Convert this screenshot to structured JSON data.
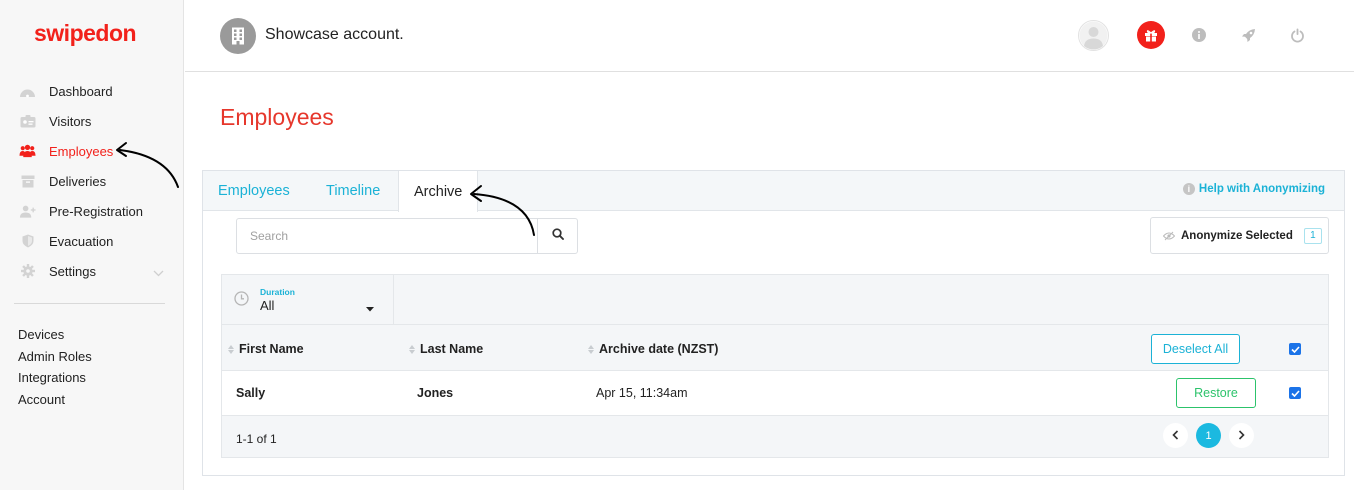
{
  "brand": {
    "logo": "swipedon",
    "accent": "#f2211b",
    "teal": "#1bb2d6",
    "green": "#2cc36b"
  },
  "sidebar": {
    "items": [
      {
        "label": "Dashboard",
        "icon": "dashboard-icon"
      },
      {
        "label": "Visitors",
        "icon": "visitors-icon"
      },
      {
        "label": "Employees",
        "icon": "employees-icon",
        "active": true
      },
      {
        "label": "Deliveries",
        "icon": "deliveries-icon"
      },
      {
        "label": "Pre-Registration",
        "icon": "pre-registration-icon"
      },
      {
        "label": "Evacuation",
        "icon": "evacuation-icon"
      },
      {
        "label": "Settings",
        "icon": "settings-icon",
        "expandable": true
      }
    ],
    "secondary": [
      "Devices",
      "Admin Roles",
      "Integrations",
      "Account"
    ]
  },
  "header": {
    "account_name": "Showcase account.",
    "icons": [
      "avatar",
      "gift-icon",
      "info-icon",
      "rocket-icon",
      "power-icon"
    ]
  },
  "page": {
    "title": "Employees"
  },
  "tabs": [
    {
      "label": "Employees"
    },
    {
      "label": "Timeline"
    },
    {
      "label": "Archive",
      "active": true
    }
  ],
  "help_link": "Help with Anonymizing",
  "search": {
    "placeholder": "Search"
  },
  "anonymize": {
    "label": "Anonymize Selected",
    "count": "1"
  },
  "filter": {
    "label": "Duration",
    "value": "All"
  },
  "table": {
    "columns": [
      "First Name",
      "Last Name",
      "Archive date (NZST)"
    ],
    "deselect_label": "Deselect All",
    "rows": [
      {
        "first_name": "Sally",
        "last_name": "Jones",
        "archive_date": "Apr 15, 11:34am",
        "action": "Restore",
        "checked": true
      }
    ],
    "footer_count": "1-1 of 1",
    "current_page": "1"
  }
}
